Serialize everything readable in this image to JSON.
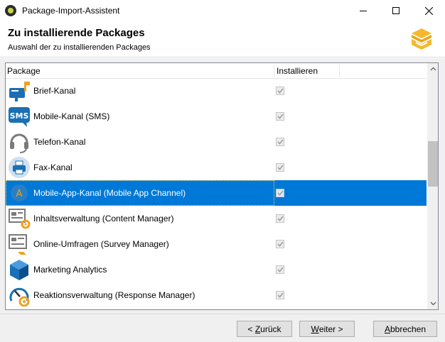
{
  "window": {
    "title": "Package-Import-Assistent"
  },
  "header": {
    "title": "Zu installierende Packages",
    "subtitle": "Auswahl der zu installierenden Packages"
  },
  "table": {
    "columns": [
      "Package",
      "Installieren"
    ],
    "rows": [
      {
        "icon": "mailbox-icon",
        "label": "Brief-Kanal",
        "checked": true,
        "selected": false
      },
      {
        "icon": "sms-icon",
        "label": "Mobile-Kanal (SMS)",
        "checked": true,
        "selected": false
      },
      {
        "icon": "headset-icon",
        "label": "Telefon-Kanal",
        "checked": true,
        "selected": false
      },
      {
        "icon": "fax-icon",
        "label": "Fax-Kanal",
        "checked": true,
        "selected": false
      },
      {
        "icon": "mobile-app-icon",
        "label": "Mobile-App-Kanal (Mobile App Channel)",
        "checked": true,
        "selected": true
      },
      {
        "icon": "content-manager-icon",
        "label": "Inhaltsverwaltung (Content Manager)",
        "checked": true,
        "selected": false
      },
      {
        "icon": "survey-icon",
        "label": "Online-Umfragen (Survey Manager)",
        "checked": true,
        "selected": false
      },
      {
        "icon": "cube-icon",
        "label": "Marketing Analytics",
        "checked": true,
        "selected": false
      },
      {
        "icon": "gauge-icon",
        "label": "Reaktionsverwaltung (Response Manager)",
        "checked": true,
        "selected": false
      }
    ]
  },
  "buttons": {
    "back": {
      "accel": "Z",
      "rest": "urück",
      "prefix": "< "
    },
    "next": {
      "accel": "W",
      "rest": "eiter >"
    },
    "cancel": {
      "accel": "A",
      "rest": "bbrechen"
    }
  },
  "colors": {
    "selection": "#0078d7",
    "accent_orange": "#f0a020",
    "icon_blue": "#1a6fb5"
  }
}
